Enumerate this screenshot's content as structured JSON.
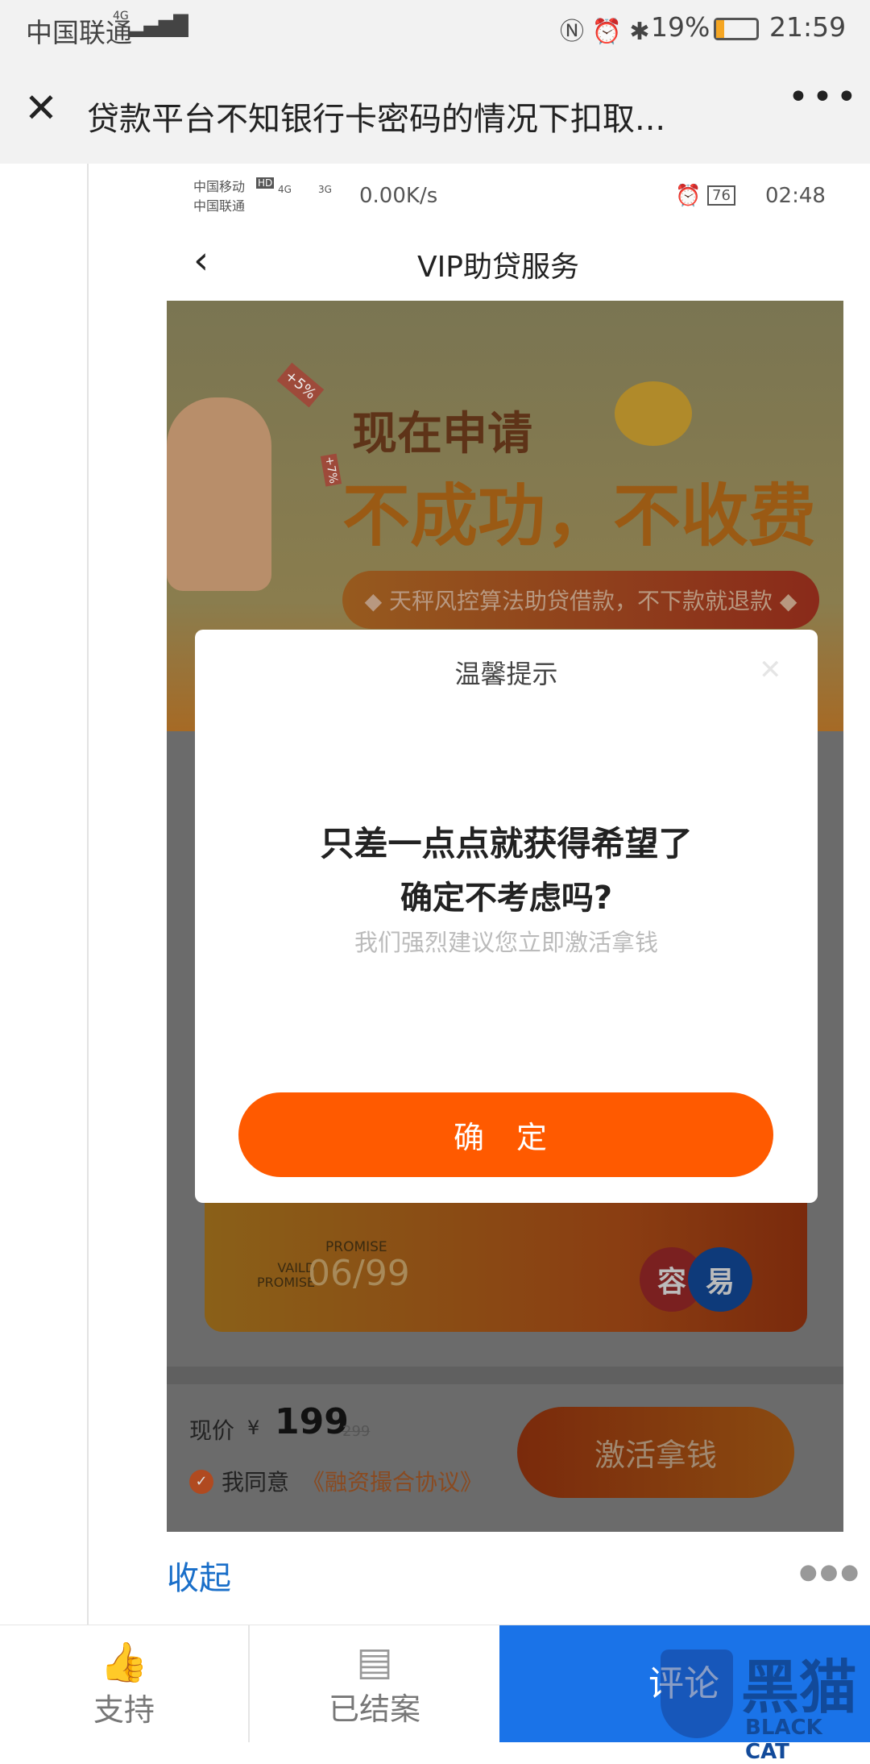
{
  "outer_status": {
    "carrier": "中国联通",
    "network": "4G",
    "battery": "19%",
    "time": "21:59"
  },
  "titlebar": {
    "title": "贷款平台不知银行卡密码的情况下扣取...",
    "close_icon": "close-icon",
    "more_icon": "more-icon"
  },
  "inner_status": {
    "carrier1": "中国移动",
    "hd": "HD",
    "carrier2": "中国联通",
    "net1": "4G",
    "net2": "3G",
    "speed": "0.00K/s",
    "battery": "76",
    "time": "02:48"
  },
  "inner_nav": {
    "title": "VIP助贷服务"
  },
  "banner": {
    "line1": "现在申请",
    "line2": "不成功，不收费",
    "pill": "◆ 天秤风控算法助贷借款，不下款就退款 ◆",
    "tag1": "+5%",
    "tag2": "+7%"
  },
  "card": {
    "promise": "PROMISE",
    "valid": "VAILD",
    "promise2": "PROMISE",
    "date": "06/99",
    "logo_left": "容",
    "logo_right": "易"
  },
  "price": {
    "label": "现价",
    "currency": "¥",
    "value": "199",
    "original": "299",
    "agree": "我同意",
    "agreement": "《融资撮合协议》",
    "activate": "激活拿钱"
  },
  "modal": {
    "title": "温馨提示",
    "line1": "只差一点点就获得希望了",
    "line2": "确定不考虑吗?",
    "sub": "我们强烈建议您立即激活拿钱",
    "confirm": "确 定"
  },
  "collapse": "收起",
  "bottom": {
    "support": "支持",
    "closed": "已结案",
    "comment": "评论",
    "watermark": "黑猫",
    "watermark_en": "BLACK CAT"
  },
  "colors": {
    "accent": "#ff5a00",
    "blue": "#1a73e8",
    "link": "#1a6fc9"
  }
}
